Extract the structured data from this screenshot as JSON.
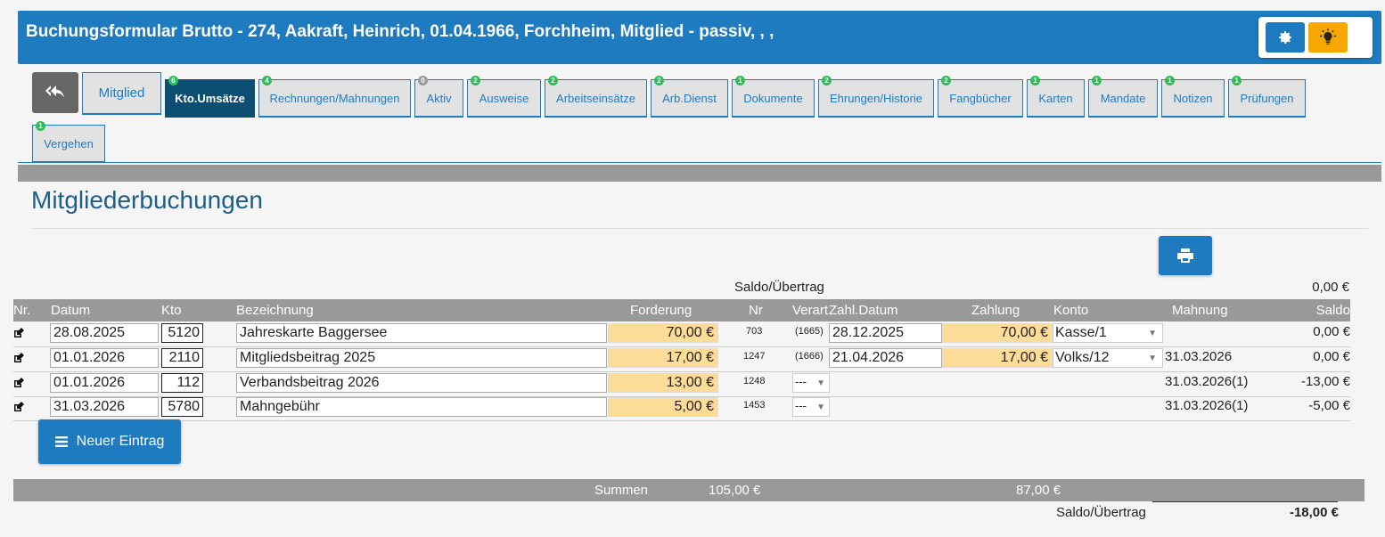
{
  "header": {
    "title": "Buchungsformular Brutto - 274, Aakraft, Heinrich, 01.04.1966, Forchheim, Mitglied - passiv, , ,",
    "settings_icon": "gear-icon",
    "help_icon": "lightbulb-icon"
  },
  "tabs": {
    "mitglied": "Mitglied",
    "kto_umsaetze": {
      "label": "Kto.Umsätze",
      "badge": "6"
    },
    "rechnungen": {
      "label": "Rechnungen/Mahnungen",
      "badge": "4"
    },
    "aktiv": {
      "label": "Aktiv",
      "badge": "0"
    },
    "ausweise": {
      "label": "Ausweise",
      "badge": "2"
    },
    "arbeitseinsaetze": {
      "label": "Arbeitseinsätze",
      "badge": "2"
    },
    "arb_dienst": {
      "label": "Arb.Dienst",
      "badge": "2"
    },
    "dokumente": {
      "label": "Dokumente",
      "badge": "1"
    },
    "ehrungen": {
      "label": "Ehrungen/Historie",
      "badge": "2"
    },
    "fangbuecher": {
      "label": "Fangbücher",
      "badge": "2"
    },
    "karten": {
      "label": "Karten",
      "badge": "1"
    },
    "mandate": {
      "label": "Mandate",
      "badge": "1"
    },
    "notizen": {
      "label": "Notizen",
      "badge": "1"
    },
    "pruefungen": {
      "label": "Prüfungen",
      "badge": "1"
    },
    "vergehen": {
      "label": "Vergehen",
      "badge": "1"
    }
  },
  "page_title": "Mitgliederbuchungen",
  "saldo_top": {
    "label": "Saldo/Übertrag",
    "value": "0,00 €"
  },
  "table": {
    "headers": {
      "nr": "Nr.",
      "datum": "Datum",
      "kto": "Kto",
      "bezeichnung": "Bezeichnung",
      "forderung": "Forderung",
      "nr2": "Nr",
      "verart": "Verart",
      "zahldatum": "Zahl.Datum",
      "zahlung": "Zahlung",
      "konto": "Konto",
      "mahnung": "Mahnung",
      "saldo": "Saldo"
    },
    "rows": [
      {
        "datum": "28.08.2025",
        "kto": "5120",
        "bezeichnung": "Jahreskarte Baggersee",
        "forderung": "70,00 €",
        "nr": "703",
        "verart": "(1665)",
        "zahldatum": "28.12.2025",
        "zahlung": "70,00 €",
        "konto": "Kasse/1",
        "mahnung": "",
        "saldo": "0,00 €"
      },
      {
        "datum": "01.01.2026",
        "kto": "2110",
        "bezeichnung": "Mitgliedsbeitrag 2025",
        "forderung": "17,00 €",
        "nr": "1247",
        "verart": "(1666)",
        "zahldatum": "21.04.2026",
        "zahlung": "17,00 €",
        "konto": "Volks/12",
        "mahnung": "31.03.2026",
        "saldo": "0,00 €"
      },
      {
        "datum": "01.01.2026",
        "kto": "112",
        "bezeichnung": "Verbandsbeitrag 2026",
        "forderung": "13,00 €",
        "nr": "1248",
        "verart": "---",
        "zahldatum": "",
        "zahlung": "",
        "konto": "",
        "mahnung": "31.03.2026(1)",
        "saldo": "-13,00 €"
      },
      {
        "datum": "31.03.2026",
        "kto": "5780",
        "bezeichnung": "Mahngebühr",
        "forderung": "5,00 €",
        "nr": "1453",
        "verart": "---",
        "zahldatum": "",
        "zahlung": "",
        "konto": "",
        "mahnung": "31.03.2026(1)",
        "saldo": "-5,00 €"
      }
    ]
  },
  "new_entry_label": "Neuer Eintrag",
  "summen": {
    "label": "Summen",
    "forderung": "105,00 €",
    "zahlung": "87,00 €"
  },
  "saldo_bottom": {
    "label": "Saldo/Übertrag",
    "value": "-18,00 €"
  },
  "colors": {
    "primary": "#1f7bbf",
    "active_tab": "#0d4f73",
    "amount_bg": "#fddc98",
    "badge": "#2ebd59",
    "warning": "#f6a800"
  }
}
